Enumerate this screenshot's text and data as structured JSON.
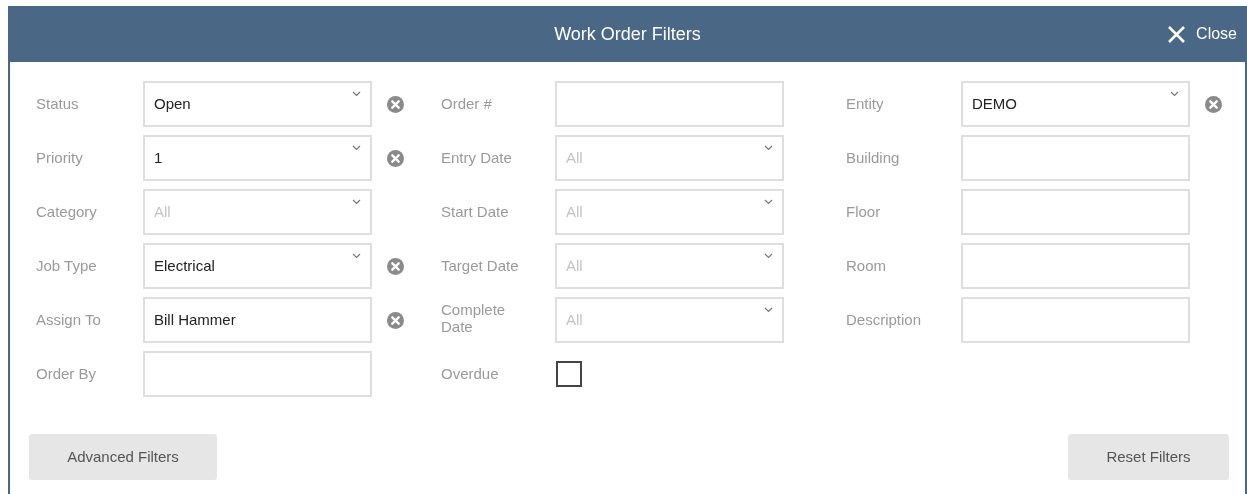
{
  "window": {
    "title": "Work Order Filters",
    "close_label": "Close"
  },
  "columns": [
    {
      "fields": [
        {
          "label": "Status",
          "kind": "select",
          "value": "Open",
          "clearable": true
        },
        {
          "label": "Priority",
          "kind": "select",
          "value": "1",
          "clearable": true
        },
        {
          "label": "Category",
          "kind": "select",
          "placeholder": "All",
          "clearable": false
        },
        {
          "label": "Job Type",
          "kind": "select",
          "value": "Electrical",
          "clearable": true
        },
        {
          "label": "Assign To",
          "kind": "text",
          "value": "Bill Hammer",
          "clearable": true
        },
        {
          "label": "Order By",
          "kind": "text",
          "clearable": false
        }
      ]
    },
    {
      "fields": [
        {
          "label": "Order #",
          "kind": "text",
          "clearable": false
        },
        {
          "label": "Entry Date",
          "kind": "select",
          "placeholder": "All",
          "clearable": false
        },
        {
          "label": "Start Date",
          "kind": "select",
          "placeholder": "All",
          "clearable": false
        },
        {
          "label": "Target Date",
          "kind": "select",
          "placeholder": "All",
          "clearable": false
        },
        {
          "label": "Complete Date",
          "kind": "select",
          "placeholder": "All",
          "clearable": false
        },
        {
          "label": "Overdue",
          "kind": "checkbox",
          "checked": false
        }
      ]
    },
    {
      "fields": [
        {
          "label": "Entity",
          "kind": "select",
          "value": "DEMO",
          "clearable": true
        },
        {
          "label": "Building",
          "kind": "text",
          "clearable": false
        },
        {
          "label": "Floor",
          "kind": "text",
          "clearable": false
        },
        {
          "label": "Room",
          "kind": "text",
          "clearable": false
        },
        {
          "label": "Description",
          "kind": "text",
          "clearable": false
        }
      ]
    }
  ],
  "buttons": [
    {
      "label": "Advanced Filters"
    },
    {
      "label": "Reset Filters"
    }
  ]
}
